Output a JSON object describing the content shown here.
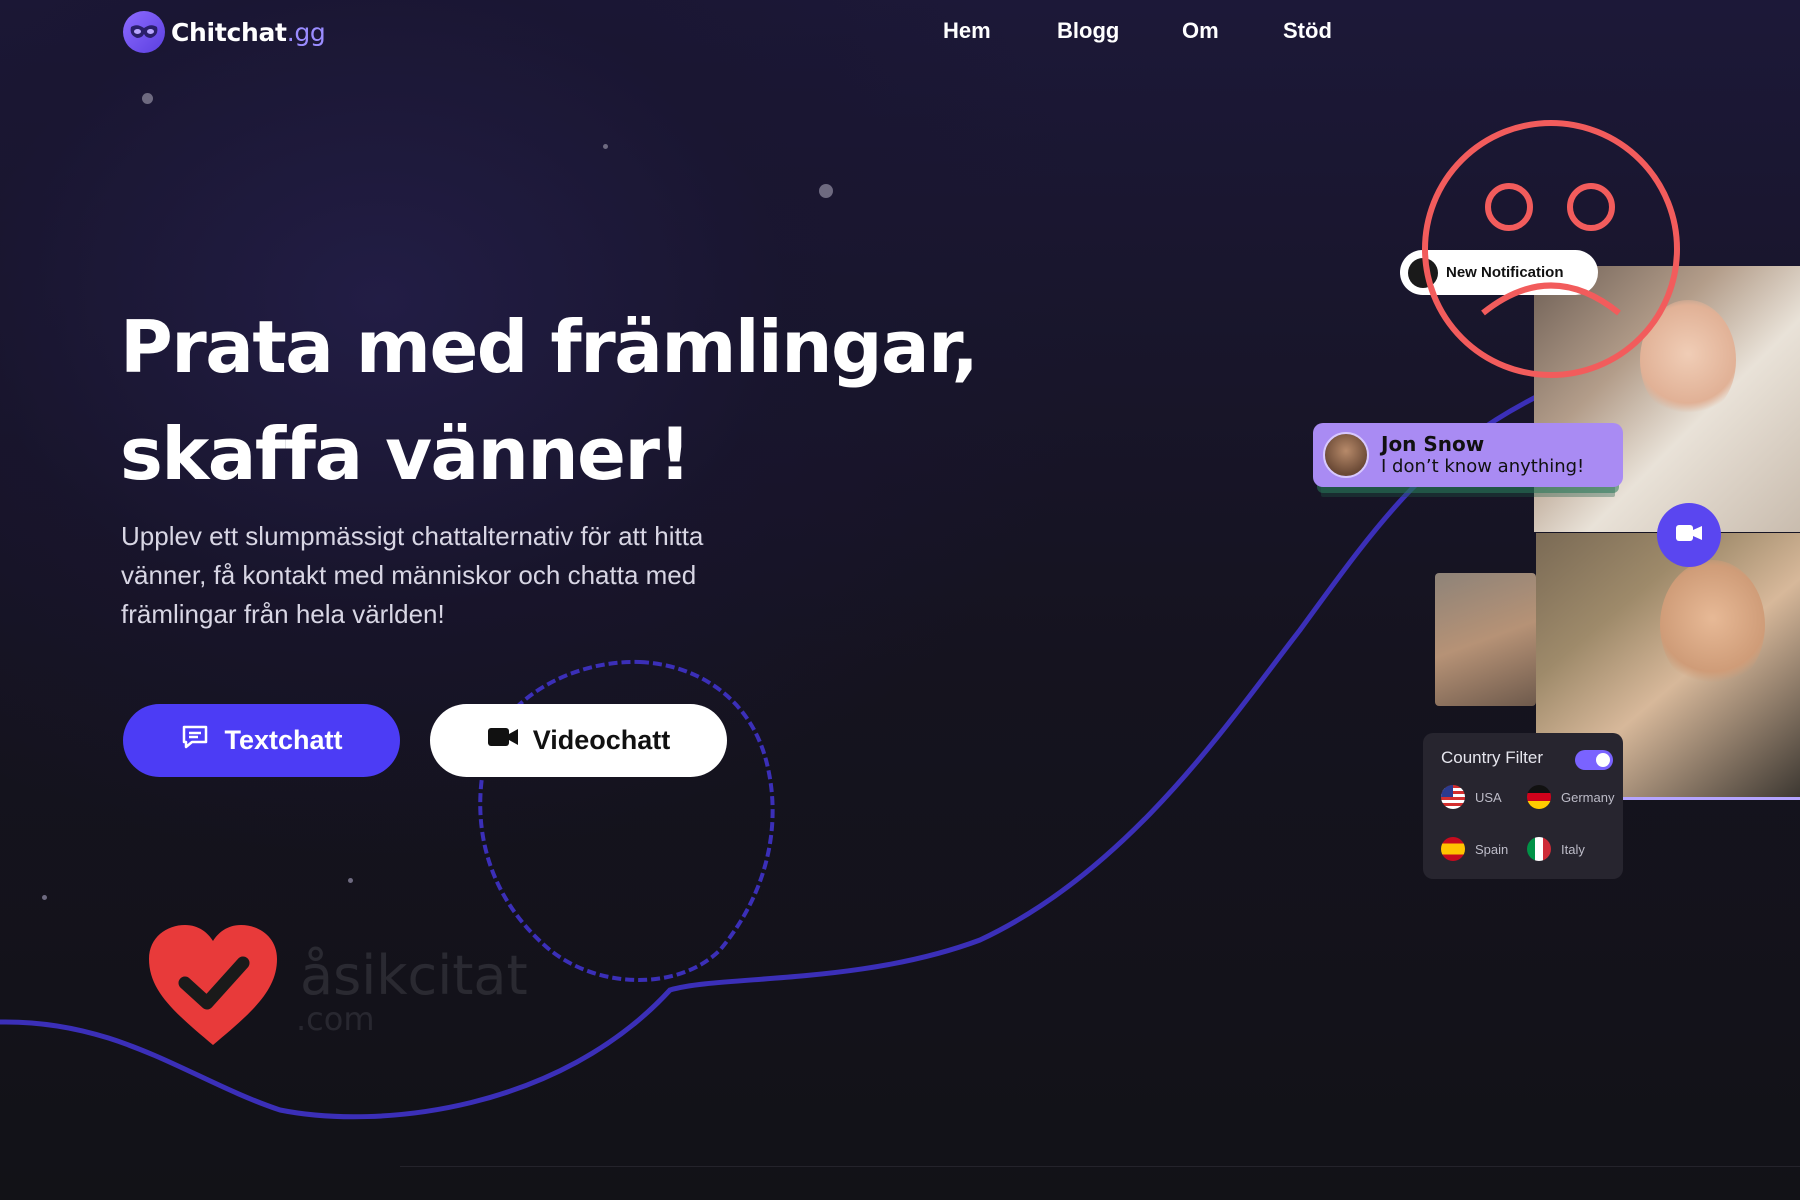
{
  "brand": {
    "name": "Chitchat",
    "suffix": ".gg",
    "logo_icon": "mask-icon"
  },
  "nav": {
    "items": [
      "Hem",
      "Blogg",
      "Om",
      "Stöd"
    ]
  },
  "hero": {
    "headline_line1": "Prata med främlingar,",
    "headline_line2": "skaffa vänner!",
    "subtext": "Upplev ett slumpmässigt chattalternativ för att hitta vänner, få kontakt med människor och chatta med främlingar från hela världen!"
  },
  "buttons": {
    "text_chat": {
      "label": "Textchatt",
      "icon": "chat-bubble-icon"
    },
    "video_chat": {
      "label": "Videochatt",
      "icon": "video-camera-icon"
    }
  },
  "notification": {
    "label": "New Notification",
    "icon": "bell-icon"
  },
  "chat_bubble": {
    "name": "Jon Snow",
    "message": "I don’t know anything!"
  },
  "country_filter": {
    "title": "Country Filter",
    "enabled": true,
    "countries": [
      "USA",
      "Germany",
      "Spain",
      "Italy"
    ]
  },
  "watermark": {
    "text": "åsikcitat",
    "sub": ".com"
  },
  "colors": {
    "accent": "#4c3cf5",
    "curve": "#3b2fb8",
    "sad_face": "#f25c5c",
    "watermark_heart": "#e83a3a",
    "chat_bubble": "#a98bf3"
  }
}
